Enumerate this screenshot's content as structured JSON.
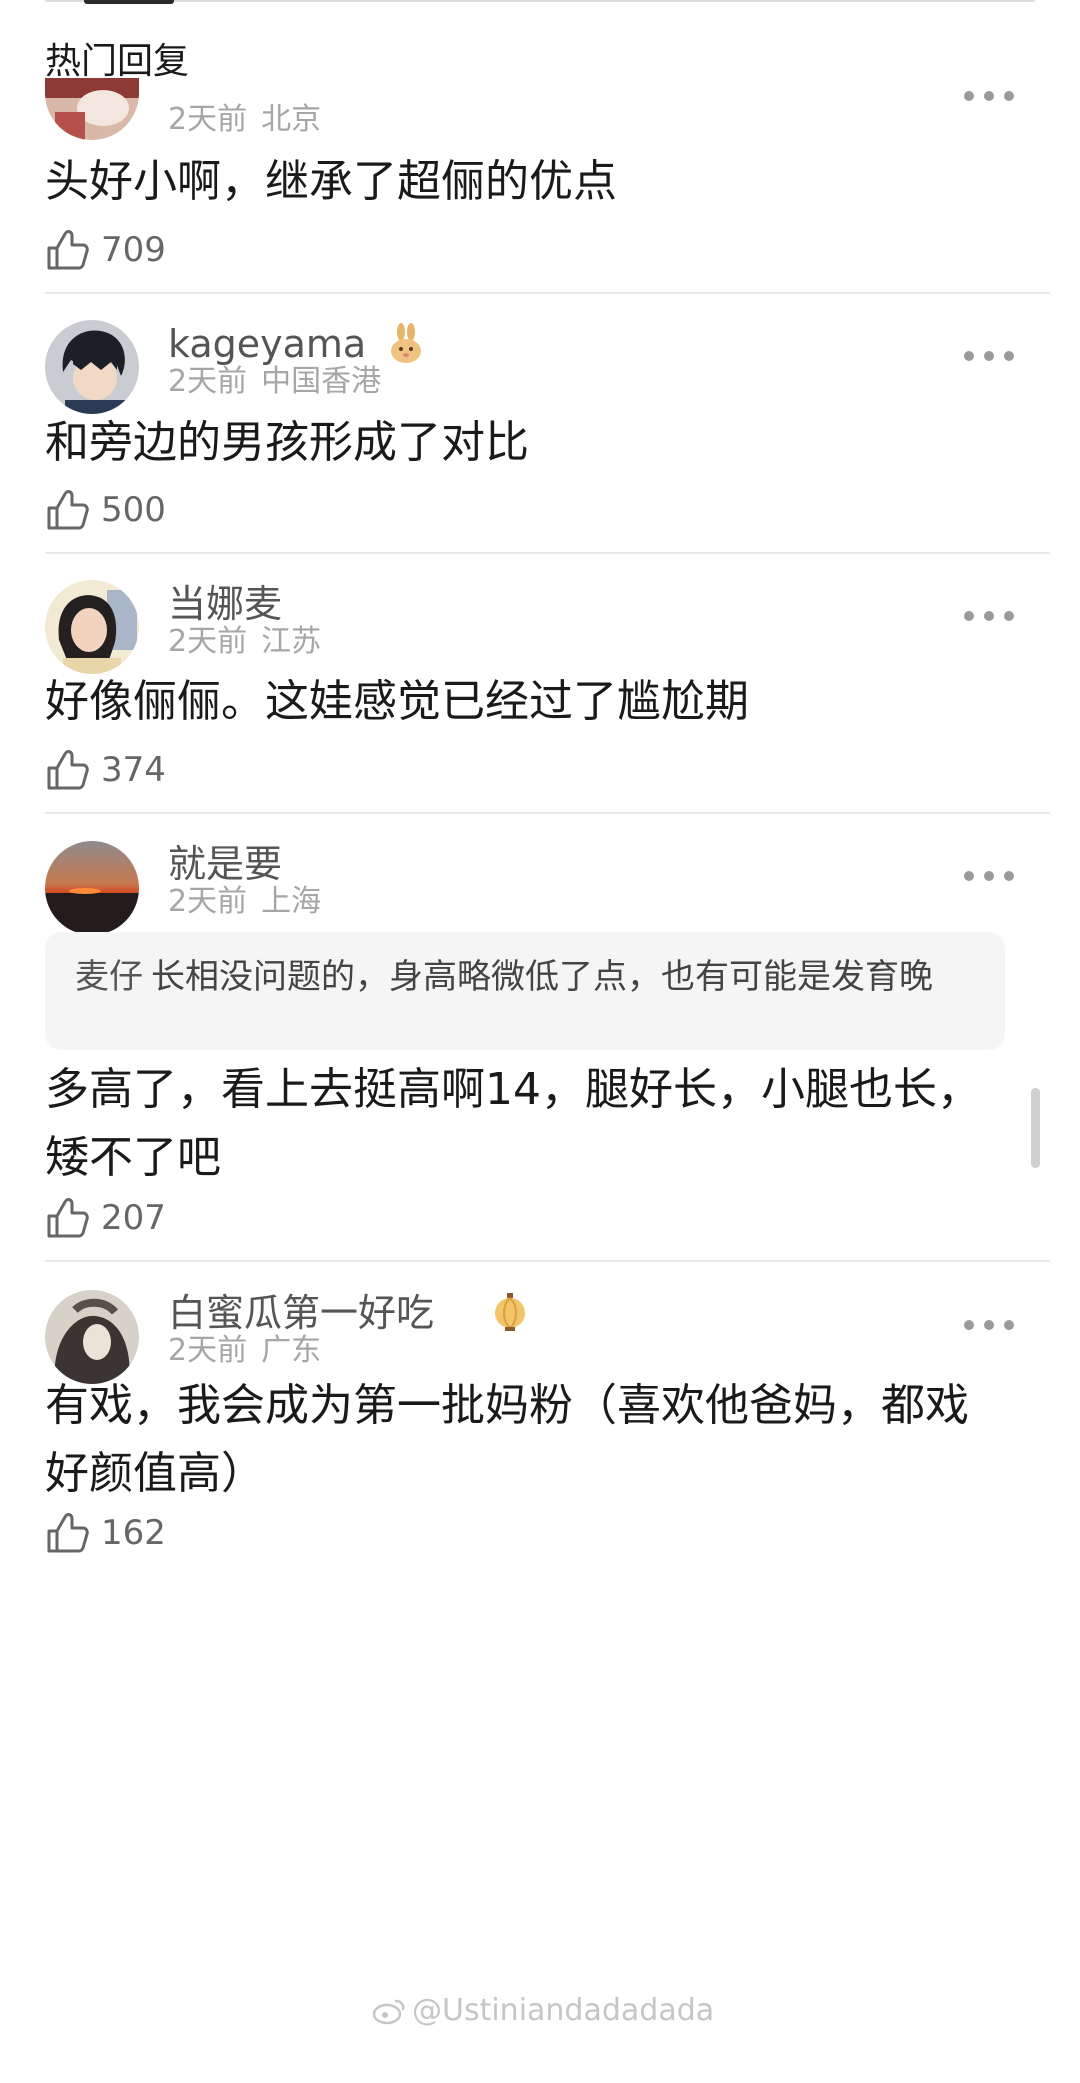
{
  "header": {
    "title": "热门回复"
  },
  "comments": [
    {
      "username": "",
      "time": "2天前",
      "location": "北京",
      "body": "头好小啊，继承了超俪的优点",
      "likes": "709"
    },
    {
      "username": "kageyama",
      "badge_icon": "rabbit-icon",
      "time": "2天前",
      "location": "中国香港",
      "body": "和旁边的男孩形成了对比",
      "likes": "500"
    },
    {
      "username": "当娜麦",
      "time": "2天前",
      "location": "江苏",
      "body": "好像俪俪。这娃感觉已经过了尴尬期",
      "likes": "374"
    },
    {
      "username": "就是要",
      "time": "2天前",
      "location": "上海",
      "quote": {
        "author": "麦仔",
        "text": "长相没问题的，身高略微低了点，也有可能是发育晚"
      },
      "body": "多高了，看上去挺高啊14，腿好长，小腿也长，矮不了吧",
      "likes": "207"
    },
    {
      "username": "白蜜瓜第一好吃",
      "badge_icon": "lantern-icon",
      "time": "2天前",
      "location": "广东",
      "body": "有戏，我会成为第一批妈粉（喜欢他爸妈，都戏好颜值高）",
      "likes": "162"
    }
  ],
  "watermark": "@Ustiniandadadada",
  "colors": {
    "text_primary": "#1a1a1a",
    "text_secondary": "#a6a6a6",
    "username": "#555555",
    "divider": "#e8e8e8",
    "quote_bg": "#f5f5f5"
  }
}
